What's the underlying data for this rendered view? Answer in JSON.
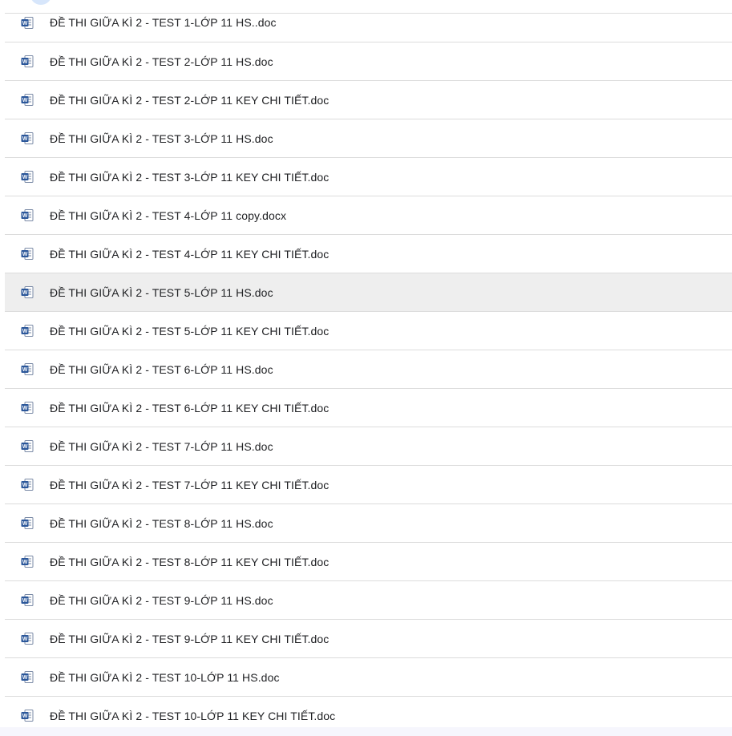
{
  "file_list": {
    "files": [
      {
        "name": "ĐỀ THI GIỮA KÌ 2 - TEST 1-LỚP 11 HS..doc",
        "icon": "word-doc-icon"
      },
      {
        "name": "ĐỀ THI GIỮA KÌ 2 - TEST 2-LỚP 11 HS.doc",
        "icon": "word-doc-icon"
      },
      {
        "name": "ĐỀ THI GIỮA KÌ 2 - TEST 2-LỚP 11 KEY CHI TIẾT.doc",
        "icon": "word-doc-icon"
      },
      {
        "name": "ĐỀ THI GIỮA KÌ 2 - TEST 3-LỚP 11 HS.doc",
        "icon": "word-doc-icon"
      },
      {
        "name": "ĐỀ THI GIỮA KÌ 2 - TEST 3-LỚP 11 KEY CHI TIẾT.doc",
        "icon": "word-doc-icon"
      },
      {
        "name": "ĐỀ THI GIỮA KÌ 2 - TEST 4-LỚP 11 copy.docx",
        "icon": "word-doc-icon"
      },
      {
        "name": "ĐỀ THI GIỮA KÌ 2 - TEST 4-LỚP 11 KEY CHI TIẾT.doc",
        "icon": "word-doc-icon"
      },
      {
        "name": "ĐỀ THI GIỮA KÌ 2 - TEST 5-LỚP 11 HS.doc",
        "icon": "word-doc-icon"
      },
      {
        "name": "ĐỀ THI GIỮA KÌ 2 - TEST 5-LỚP 11 KEY CHI TIẾT.doc",
        "icon": "word-doc-icon"
      },
      {
        "name": "ĐỀ THI GIỮA KÌ 2 - TEST 6-LỚP 11 HS.doc",
        "icon": "word-doc-icon"
      },
      {
        "name": "ĐỀ THI GIỮA KÌ 2 - TEST 6-LỚP 11 KEY CHI TIẾT.doc",
        "icon": "word-doc-icon"
      },
      {
        "name": "ĐỀ THI GIỮA KÌ 2 - TEST 7-LỚP 11 HS.doc",
        "icon": "word-doc-icon"
      },
      {
        "name": "ĐỀ THI GIỮA KÌ 2 - TEST 7-LỚP 11 KEY CHI TIẾT.doc",
        "icon": "word-doc-icon"
      },
      {
        "name": "ĐỀ THI GIỮA KÌ 2 - TEST 8-LỚP 11 HS.doc",
        "icon": "word-doc-icon"
      },
      {
        "name": "ĐỀ THI GIỮA KÌ 2 - TEST 8-LỚP 11 KEY CHI TIẾT.doc",
        "icon": "word-doc-icon"
      },
      {
        "name": "ĐỀ THI GIỮA KÌ 2 - TEST 9-LỚP 11 HS.doc",
        "icon": "word-doc-icon"
      },
      {
        "name": "ĐỀ THI GIỮA KÌ 2 - TEST 9-LỚP 11 KEY CHI TIẾT.doc",
        "icon": "word-doc-icon"
      },
      {
        "name": "ĐỀ THI GIỮA KÌ 2 - TEST 10-LỚP 11 HS.doc",
        "icon": "word-doc-icon"
      },
      {
        "name": "ĐỀ THI GIỮA KÌ 2 - TEST 10-LỚP 11 KEY CHI TIẾT.doc",
        "icon": "word-doc-icon"
      }
    ],
    "selected_index": 7
  },
  "colors": {
    "word_blue": "#2b579a",
    "row_divider": "#dcdcdc",
    "selected_row": "#eeeeee",
    "text": "#202124"
  }
}
